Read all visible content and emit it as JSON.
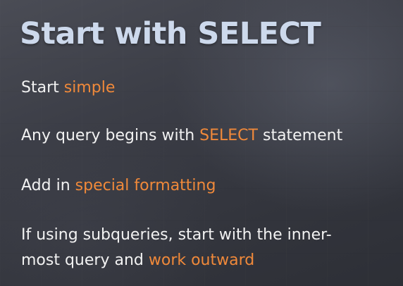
{
  "slide": {
    "title": "Start with SELECT",
    "bullets": [
      {
        "text": "Start ",
        "highlight": "simple",
        "after": ""
      },
      {
        "text": "Any query begins with ",
        "highlight": "SELECT",
        "after": " statement"
      },
      {
        "text": "Add in ",
        "highlight": "special formatting",
        "after": ""
      },
      {
        "line1": "If using subqueries, start with the inner-",
        "text": "most query and ",
        "highlight": "work outward",
        "after": ""
      }
    ]
  },
  "colors": {
    "title": "#cdd9ec",
    "body_text": "#f2f2f2",
    "highlight": "#f0893a",
    "background": "#3a3c44"
  }
}
